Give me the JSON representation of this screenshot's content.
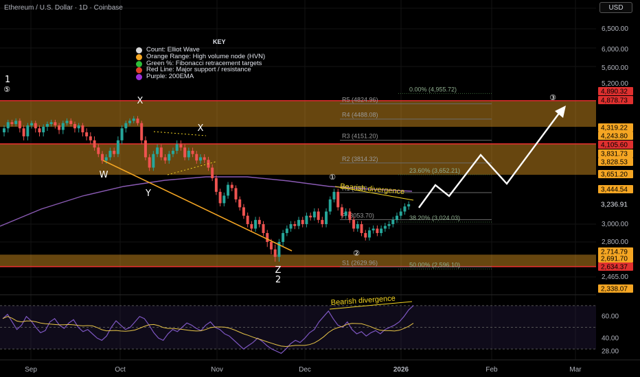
{
  "header": {
    "symbol": "Ethereum / U.S. Dollar · 1D · Coinbase",
    "currency": "USD"
  },
  "legend_key": {
    "title": "KEY",
    "items": [
      {
        "label": "Count: Elliot Wave",
        "color": "#d8d8d8"
      },
      {
        "label": "Orange Range: High volume node (HVN)",
        "color": "#f5a623"
      },
      {
        "label": "Green %: Fibonacci retracement targets",
        "color": "#2ebd3a"
      },
      {
        "label": "Red Line: Major support / resistance",
        "color": "#e0402a"
      },
      {
        "label": "Purple: 200EMA",
        "color": "#9b30d9"
      }
    ]
  },
  "colors": {
    "up": "#26a69a",
    "down": "#ef5350",
    "hvn": "#f5a623",
    "support": "#e0302f",
    "ema200": "#8b5bb5",
    "rsi": "#7e57c2",
    "rsi_ma": "#e8c547"
  },
  "chart_data": [
    {
      "type": "candlestick",
      "x_axis_labels": [
        "Sep",
        "Oct",
        "Nov",
        "Dec",
        "2026",
        "Feb",
        "Mar"
      ],
      "y_axis_labels": [
        "6,500.00",
        "6,000.00",
        "5,600.00",
        "5,200.00",
        "3,000.00",
        "2,800.00",
        "2,465.00"
      ],
      "ylim": [
        2338,
        6800
      ],
      "price_tags": [
        {
          "value": "4,890.32",
          "color": "#e0302f"
        },
        {
          "value": "4,878.73",
          "color": "#e0302f"
        },
        {
          "value": "4,319.22",
          "color": "#f5a623"
        },
        {
          "value": "4,243.80",
          "color": "#f5a623"
        },
        {
          "value": "4,105.60",
          "color": "#e0302f"
        },
        {
          "value": "3,831.73",
          "color": "#f5a623"
        },
        {
          "value": "3,828.53",
          "color": "#f5a623"
        },
        {
          "value": "3,651.20",
          "color": "#f5a623"
        },
        {
          "value": "3,444.54",
          "color": "#f5a623"
        },
        {
          "value": "3,236.91",
          "color": "#000000"
        },
        {
          "value": "2,714.79",
          "color": "#f5a623"
        },
        {
          "value": "2,691.70",
          "color": "#f5a623"
        },
        {
          "value": "2,634.37",
          "color": "#e0302f"
        },
        {
          "value": "2,338.07",
          "color": "#f5a623"
        }
      ],
      "hvn_zones": [
        [
          4319.22,
          4878.73
        ],
        [
          3651.2,
          4105.6
        ],
        [
          2634.37,
          2714.79
        ]
      ],
      "support_lines": [
        4890.32,
        4105.6,
        2634.37
      ],
      "pivots": [
        {
          "label": "R5 (4824.96)",
          "value": 4824.96
        },
        {
          "label": "R4 (4488.08)",
          "value": 4488.08
        },
        {
          "label": "R3 (4151.20)",
          "value": 4151.2
        },
        {
          "label": "R2 (3814.32)",
          "value": 3814.32
        },
        {
          "label": "R1 (3390",
          "value": 3390
        },
        {
          "label": "P (3053.70)",
          "value": 3053.7
        },
        {
          "label": "S1 (2629.96)",
          "value": 2629.96
        }
      ],
      "fibonacci": [
        {
          "label": "0.00% (4,955.72)",
          "value": 4955.72
        },
        {
          "label": "23.60% (3,652.21)",
          "value": 3652.21
        },
        {
          "label": "38.20% (3,024.03)",
          "value": 3024.03
        },
        {
          "label": "50.00% (2,596.10)",
          "value": 2596.1
        }
      ],
      "wave_labels": [
        {
          "label": "1",
          "note": "top"
        },
        {
          "label": "⑤"
        },
        {
          "label": "X"
        },
        {
          "label": "X"
        },
        {
          "label": "W"
        },
        {
          "label": "Y"
        },
        {
          "label": "①"
        },
        {
          "label": "②"
        },
        {
          "label": "③"
        },
        {
          "label": "Z"
        },
        {
          "label": "2"
        }
      ],
      "annotations": [
        "Bearish divergence"
      ],
      "candles_close_path": [
        4300,
        4420,
        4380,
        4450,
        4300,
        4200,
        4350,
        4400,
        4300,
        4250,
        4320,
        4380,
        4420,
        4350,
        4280,
        4400,
        4450,
        4380,
        4300,
        4350,
        4250,
        4200,
        4150,
        4050,
        3950,
        3850,
        3900,
        4000,
        3950,
        4150,
        4300,
        4400,
        4450,
        4500,
        4400,
        4150,
        3900,
        3750,
        3950,
        4050,
        3900,
        3850,
        3950,
        4000,
        4100,
        4050,
        3900,
        4000,
        3950,
        3850,
        3900,
        3860,
        3750,
        3600,
        3400,
        3250,
        3350,
        3500,
        3450,
        3300,
        3200,
        3100,
        3000,
        2950,
        3050,
        3000,
        2900,
        2800,
        2750,
        2700,
        2800,
        2900,
        2950,
        3000,
        2980,
        3050,
        3000,
        3100,
        3080,
        3150,
        3050,
        3000,
        3150,
        3300,
        3400,
        3200,
        3100,
        3150,
        3050,
        2950,
        3000,
        2900,
        2850,
        2930,
        2950,
        2900,
        2950,
        2980,
        3000,
        3050,
        3100,
        3150,
        3210,
        3236
      ]
    },
    {
      "type": "line",
      "name": "RSI",
      "y_axis_labels": [
        "60.00",
        "40.00",
        "28.00"
      ],
      "ylim": [
        20,
        80
      ],
      "annotations": [
        "Bearish divergence"
      ]
    }
  ]
}
